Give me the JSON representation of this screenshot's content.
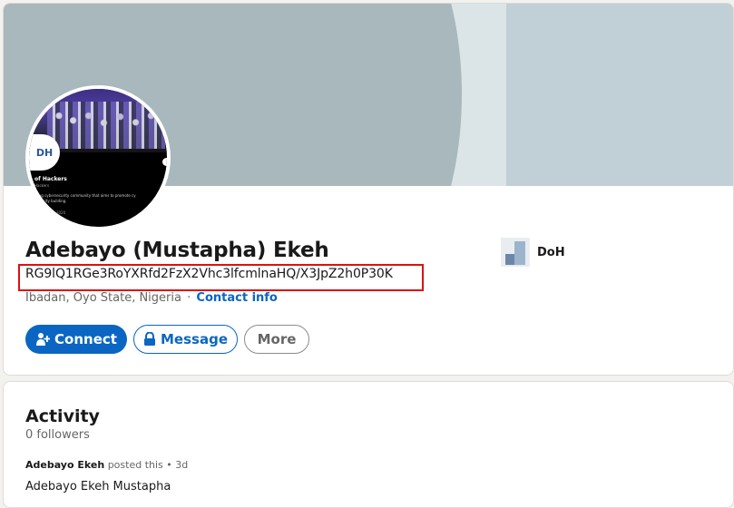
{
  "profile": {
    "name": "Adebayo (Mustapha) Ekeh",
    "headline": "RG9lQ1RGe3RoYXRfd2FzX2Vhc3lfcmlnaHQ/X3JpZ2h0P30K",
    "location": "Ibadan, Oyo State, Nigeria",
    "separator": "·",
    "contact_info_label": "Contact info",
    "company_name": "DoH",
    "avatar_text": {
      "org_title": "of Hackers",
      "org_sub": "Hackers",
      "desc_line1": "ining cybersecurity community that aims to promote cy",
      "desc_line2": "capacity building.",
      "joined": "Joined April 2020",
      "logo_letters": "DH"
    }
  },
  "actions": {
    "connect_label": "Connect",
    "message_label": "Message",
    "more_label": "More"
  },
  "activity": {
    "title": "Activity",
    "followers": "0 followers",
    "post_author": "Adebayo Ekeh",
    "post_action": "posted this",
    "post_bullet": "•",
    "post_time": "3d",
    "post_text": "Adebayo Ekeh Mustapha"
  },
  "colors": {
    "accent": "#0a66c2",
    "highlight_box": "#dd1111",
    "banner_dark": "#a8b8bd",
    "banner_light": "#c1d0d6"
  },
  "icons": {
    "connect": "add-person-icon",
    "message": "lock-icon"
  }
}
